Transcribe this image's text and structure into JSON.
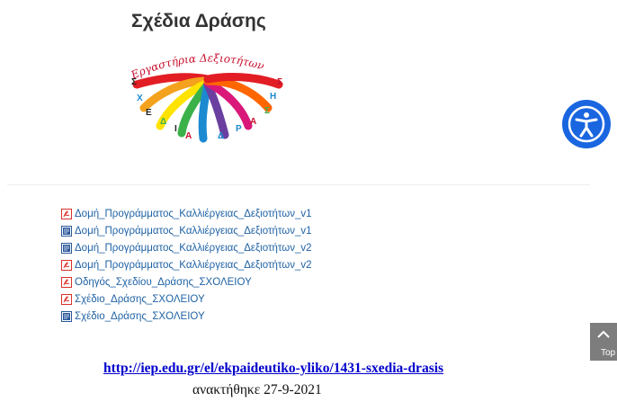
{
  "page": {
    "title": "Σχέδια Δράσης",
    "logo_caption": "Εργαστήρια Δεξιοτήτων",
    "logo_letters": [
      "Σ",
      "Χ",
      "Ε",
      "Δ",
      "Ι",
      "Α",
      "Δ",
      "Ρ",
      "Α",
      "Σ",
      "Η",
      "Σ"
    ]
  },
  "files": [
    {
      "name": "Δομή_Προγράμματος_Καλλιέργειας_Δεξιοτήτων_v1",
      "icon": "pdf-icon"
    },
    {
      "name": "Δομή_Προγράμματος_Καλλιέργειας_Δεξιοτήτων_v1",
      "icon": "word-doc-icon"
    },
    {
      "name": "Δομή_Προγράμματος_Καλλιέργειας_Δεξιοτήτων_v2",
      "icon": "word-doc-icon"
    },
    {
      "name": "Δομή_Προγράμματος_Καλλιέργειας_Δεξιοτήτων_v2",
      "icon": "pdf-icon"
    },
    {
      "name": "Οδηγός_Σχεδίου_Δράσης_ΣΧΟΛΕΙΟΥ",
      "icon": "pdf-icon"
    },
    {
      "name": "Σχέδιο_Δράσης_ΣΧΟΛΕΙΟΥ",
      "icon": "pdf-icon"
    },
    {
      "name": "Σχέδιο_Δράσης_ΣΧΟΛΕΙΟΥ",
      "icon": "word-doc-icon"
    }
  ],
  "accessibility_button": {
    "icon": "accessibility-icon"
  },
  "back_to_top": {
    "label": "Top",
    "icon": "chevron-up-icon"
  },
  "footer": {
    "source_url": "http://iep.edu.gr/el/ekpaideutiko-yliko/1431-sxedia-drasis",
    "retrieved": "ανακτήθηκε 27-9-2021"
  },
  "colors": {
    "link": "#1f62a5",
    "accessibility_bg": "#1a66e0",
    "pdf_icon": "#d9312b",
    "doc_icon": "#2b579a"
  }
}
